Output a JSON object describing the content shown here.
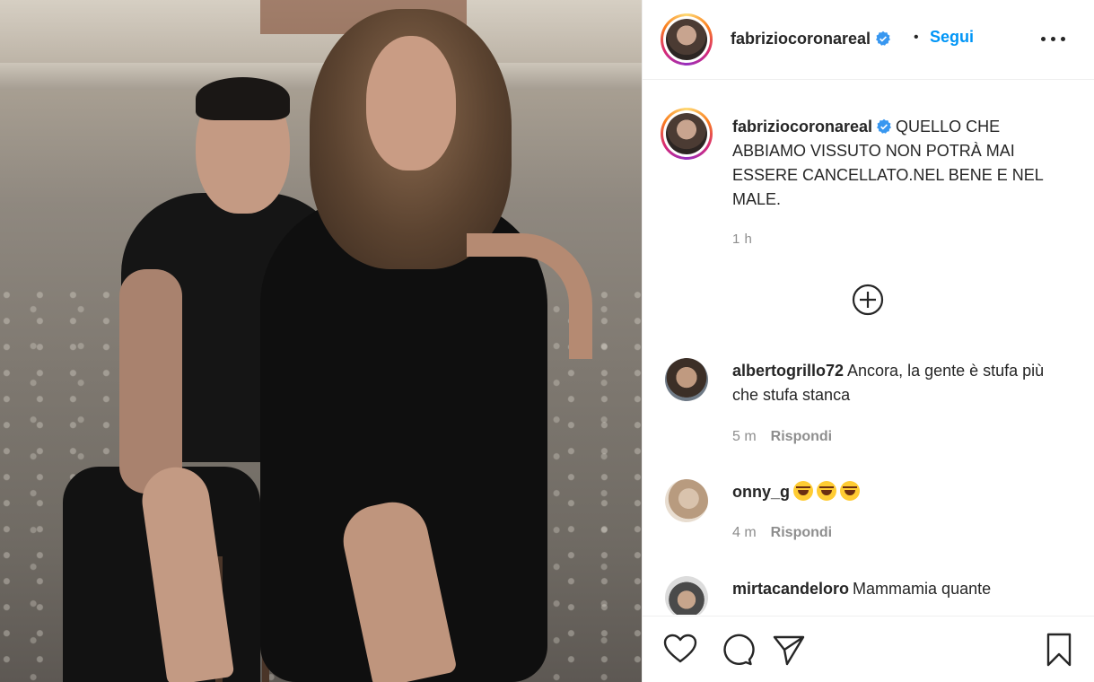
{
  "post": {
    "author": "fabriziocoronareal",
    "follow_label": "Segui",
    "dot": "•",
    "caption_text": "QUELLO CHE ABBIAMO VISSUTO NON POTRÀ MAI ESSERE CANCELLATO.NEL BENE E NEL MALE.",
    "time": "1 h"
  },
  "comments": [
    {
      "user": "albertogrillo72",
      "text": "Ancora, la gente è stufa più che stufa stanca",
      "time": "5 m",
      "reply": "Rispondi"
    },
    {
      "user": "onny_g",
      "text": "",
      "emoji_count": 3,
      "time": "4 m",
      "reply": "Rispondi"
    },
    {
      "user": "mirtacandeloro",
      "text": "Mammamia quante",
      "time": "",
      "reply": ""
    }
  ],
  "icons": {
    "verified": "verified-badge-icon",
    "more": "more-options-icon",
    "load_more": "plus-circle-icon",
    "like": "heart-icon",
    "comment": "comment-icon",
    "share": "paper-plane-icon",
    "save": "bookmark-icon"
  },
  "colors": {
    "accent": "#0095f6",
    "verified": "#3897f0",
    "muted": "#8e8e8e",
    "text": "#262626"
  }
}
